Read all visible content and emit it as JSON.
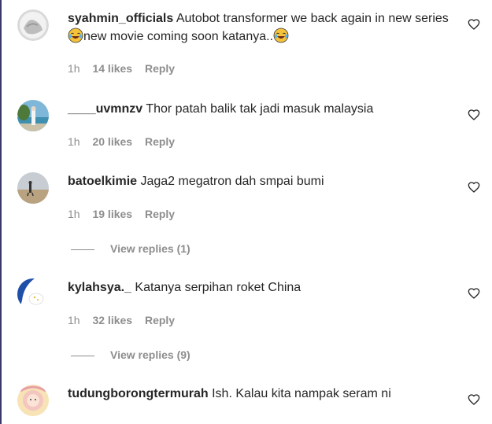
{
  "comments": [
    {
      "username": "syahmin_officials",
      "text_part1": "Autobot transformer we back again in new series",
      "emoji1": "tears-of-joy-emoji",
      "text_part2": "new movie coming soon katanya..",
      "emoji2": "tears-of-joy-emoji",
      "time": "1h",
      "likes": "14 likes",
      "reply": "Reply",
      "icon": "heart-outline-icon"
    },
    {
      "username": "____uvmnzv",
      "text": "Thor patah balik tak jadi masuk malaysia",
      "time": "1h",
      "likes": "20 likes",
      "reply": "Reply",
      "icon": "heart-outline-icon"
    },
    {
      "username": "batoelkimie",
      "text": "Jaga2 megatron dah smpai bumi",
      "time": "1h",
      "likes": "19 likes",
      "reply": "Reply",
      "view_replies": "View replies (1)",
      "icon": "heart-outline-icon"
    },
    {
      "username": "kylahsya._",
      "text": "Katanya serpihan roket China",
      "time": "1h",
      "likes": "32 likes",
      "reply": "Reply",
      "view_replies": "View replies (9)",
      "icon": "heart-outline-icon"
    },
    {
      "username": "tudungborongtermurah",
      "text": "Ish. Kalau kita nampak seram ni",
      "icon": "heart-outline-icon"
    }
  ]
}
